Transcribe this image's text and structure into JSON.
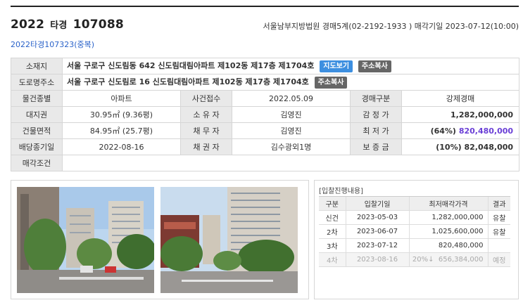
{
  "header": {
    "year": "2022",
    "type": "타경",
    "number": "107088",
    "court": "서울남부지방법원",
    "dept": "경매5계(02-2192-1933 )",
    "sale_label": "매각기일",
    "sale_date": "2023-07-12(10:00)",
    "dup_case": "2022타경107323(중복)"
  },
  "info": {
    "address_label": "소재지",
    "address": "서울 구로구 신도림동 642 신도림대림아파트 제102동 제17층 제1704호",
    "map_button": "지도보기",
    "copy_button": "주소복사",
    "road_label": "도로명주소",
    "road_address": "서울 구로구 신도림로 16 신도림대림아파트 제102동 제17층 제1704호",
    "road_copy_button": "주소복사",
    "rows": [
      {
        "l1": "물건종별",
        "v1": "아파트",
        "l2": "사건접수",
        "v2": "2022.05.09",
        "l3": "경매구분",
        "v3": "강제경매"
      },
      {
        "l1": "대지권",
        "v1": "30.95㎡ (9.36평)",
        "l2": "소 유 자",
        "v2": "김영진",
        "l3": "감 정 가",
        "v3": "1,282,000,000"
      },
      {
        "l1": "건물면적",
        "v1": "84.95㎡ (25.7평)",
        "l2": "채 무 자",
        "v2": "김영진",
        "l3": "최 저 가",
        "v3_pct": "(64%)",
        "v3": "820,480,000"
      },
      {
        "l1": "배당종기일",
        "v1": "2022-08-16",
        "l2": "채 권 자",
        "v2": "김수광외1명",
        "l3": "보 증 금",
        "v3": "(10%) 82,048,000"
      }
    ],
    "condition_label": "매각조건",
    "condition": ""
  },
  "bidding": {
    "title": "[입찰진행내용]",
    "headers": [
      "구분",
      "입찰기일",
      "최저매각가격",
      "결과"
    ],
    "rows": [
      {
        "round": "신건",
        "date": "2023-05-03",
        "pct": "",
        "price": "1,282,000,000",
        "result": "유찰"
      },
      {
        "round": "2차",
        "date": "2023-06-07",
        "pct": "",
        "price": "1,025,600,000",
        "result": "유찰"
      },
      {
        "round": "3차",
        "date": "2023-07-12",
        "pct": "",
        "price": "820,480,000",
        "result": ""
      },
      {
        "round": "4차",
        "date": "2023-08-16",
        "pct": "20%↓",
        "price": "656,384,000",
        "result": "예정"
      }
    ]
  },
  "colors": {
    "accent_blue": "#3d8fe0",
    "link_blue": "#2a62c9",
    "min_price_purple": "#6a3fd6"
  }
}
